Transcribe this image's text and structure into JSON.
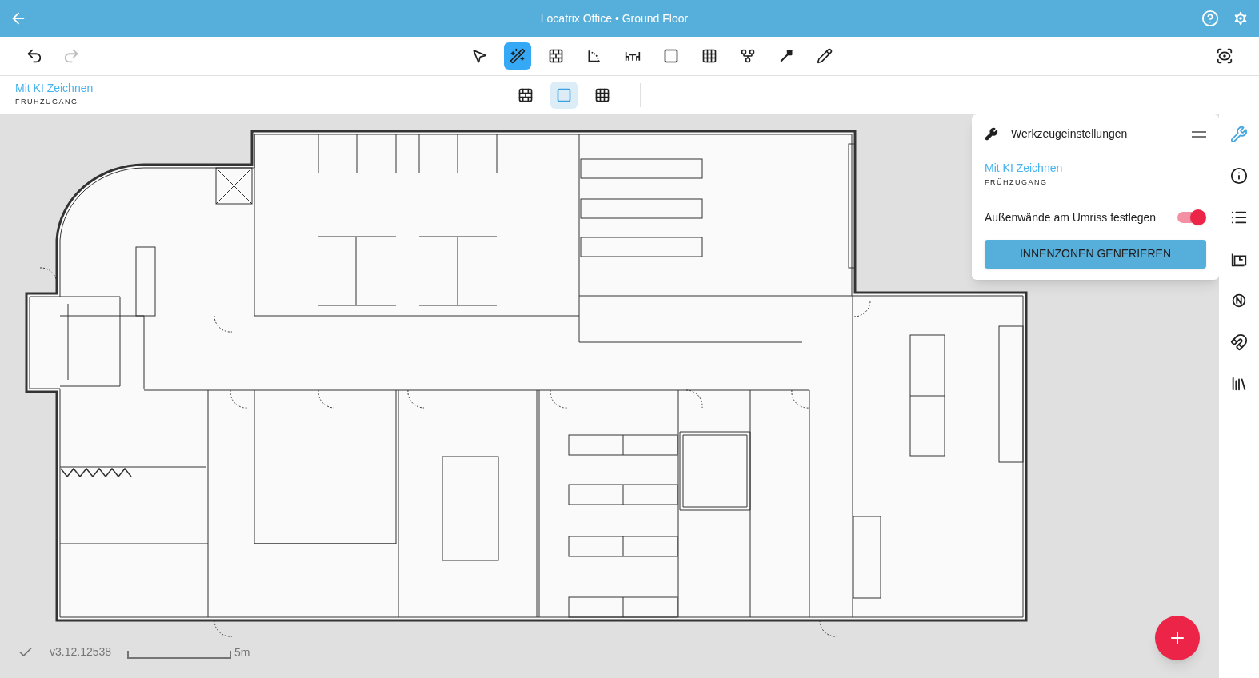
{
  "header": {
    "title": "Locatrix Office • Ground Floor"
  },
  "toolbar": {
    "undo_disabled": false,
    "redo_disabled": true,
    "tools": [
      {
        "selected": false
      },
      {
        "selected": true
      },
      {
        "selected": false
      },
      {
        "selected": false
      },
      {
        "selected": false
      },
      {
        "selected": false
      },
      {
        "selected": false
      },
      {
        "selected": false
      },
      {
        "selected": false
      },
      {
        "selected": false
      }
    ]
  },
  "mode": {
    "title": "Mit KI Zeichnen",
    "subtitle": "FRÜHZUGANG",
    "subtools": [
      {
        "selected": false
      },
      {
        "selected": true
      },
      {
        "selected": false
      }
    ]
  },
  "panel": {
    "title": "Werkzeugeinstellungen",
    "mode_title": "Mit KI Zeichnen",
    "mode_subtitle": "FRÜHZUGANG",
    "toggle": {
      "label": "Außenwände am Umriss festlegen",
      "on": true
    },
    "button": "INNENZONEN GENERIEREN"
  },
  "sidebar": [
    {
      "selected": true
    },
    {
      "selected": false
    },
    {
      "selected": false
    },
    {
      "selected": false
    },
    {
      "selected": false
    },
    {
      "selected": false
    },
    {
      "selected": false
    }
  ],
  "status": {
    "version": "v3.12.12538",
    "scale": "5m"
  }
}
